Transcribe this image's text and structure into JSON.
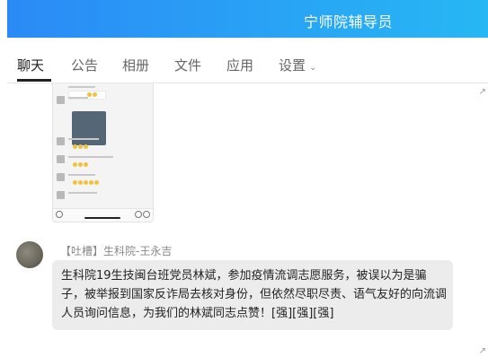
{
  "window": {
    "title": "宁师院辅导员"
  },
  "tabs": [
    {
      "label": "聊天",
      "active": true
    },
    {
      "label": "公告"
    },
    {
      "label": "相册"
    },
    {
      "label": "文件"
    },
    {
      "label": "应用"
    },
    {
      "label": "设置"
    }
  ],
  "message": {
    "sender": "【吐槽】生科院-王永吉",
    "text": "生科院19生技闽台班党员林斌，参加疫情流调志愿服务，被误以为是骗子，被举报到国家反诈局去核对身份，但依然尽职尽责、语气友好的向流调人员询问信息，为我们的林斌同志点赞！[强][强][强]"
  },
  "icons": {
    "settings_dropdown": "chevron-down-icon",
    "expand": "expand-arrow-icon"
  },
  "colors": {
    "header_gradient_start": "#2b8af6",
    "header_gradient_end": "#27b7f4",
    "bubble": "#ececec"
  }
}
